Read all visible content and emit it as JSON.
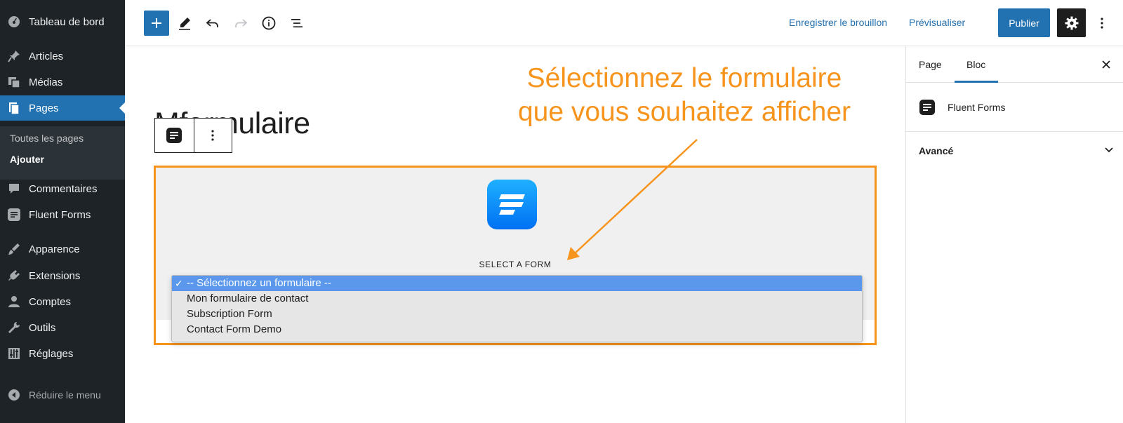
{
  "sidebar": {
    "items": [
      {
        "label": "Tableau de bord",
        "icon": "dashboard-icon"
      },
      {
        "label": "Articles",
        "icon": "pin-icon"
      },
      {
        "label": "Médias",
        "icon": "media-icon"
      },
      {
        "label": "Pages",
        "icon": "pages-icon",
        "active": true
      },
      {
        "label": "Commentaires",
        "icon": "comment-icon"
      },
      {
        "label": "Fluent Forms",
        "icon": "fluent-forms-icon"
      },
      {
        "label": "Apparence",
        "icon": "brush-icon"
      },
      {
        "label": "Extensions",
        "icon": "plugin-icon"
      },
      {
        "label": "Comptes",
        "icon": "user-icon"
      },
      {
        "label": "Outils",
        "icon": "wrench-icon"
      },
      {
        "label": "Réglages",
        "icon": "settings-sliders-icon"
      }
    ],
    "submenu": [
      "Toutes les pages",
      "Ajouter"
    ],
    "collapse_label": "Réduire le menu"
  },
  "toolbar": {
    "draft_label": "Enregistrer le brouillon",
    "preview_label": "Prévisualiser",
    "publish_label": "Publier"
  },
  "editor": {
    "title_visible": "formulaire",
    "title_partial_glyph": "M"
  },
  "block": {
    "select_label": "SELECT A FORM",
    "options": [
      {
        "label": "-- Sélectionnez un formulaire --",
        "selected": true
      },
      {
        "label": "Mon formulaire de contact",
        "selected": false
      },
      {
        "label": "Subscription Form",
        "selected": false
      },
      {
        "label": "Contact Form Demo",
        "selected": false
      }
    ]
  },
  "annotation": {
    "line1": "Sélectionnez le formulaire",
    "line2": "que vous souhaitez afficher",
    "color": "#f7941d"
  },
  "panel": {
    "tab_page": "Page",
    "tab_block": "Bloc",
    "block_name": "Fluent Forms",
    "advanced_label": "Avancé"
  },
  "colors": {
    "accent": "#2271b1",
    "sidebar_bg": "#1d2327",
    "highlight": "#f7941d"
  }
}
